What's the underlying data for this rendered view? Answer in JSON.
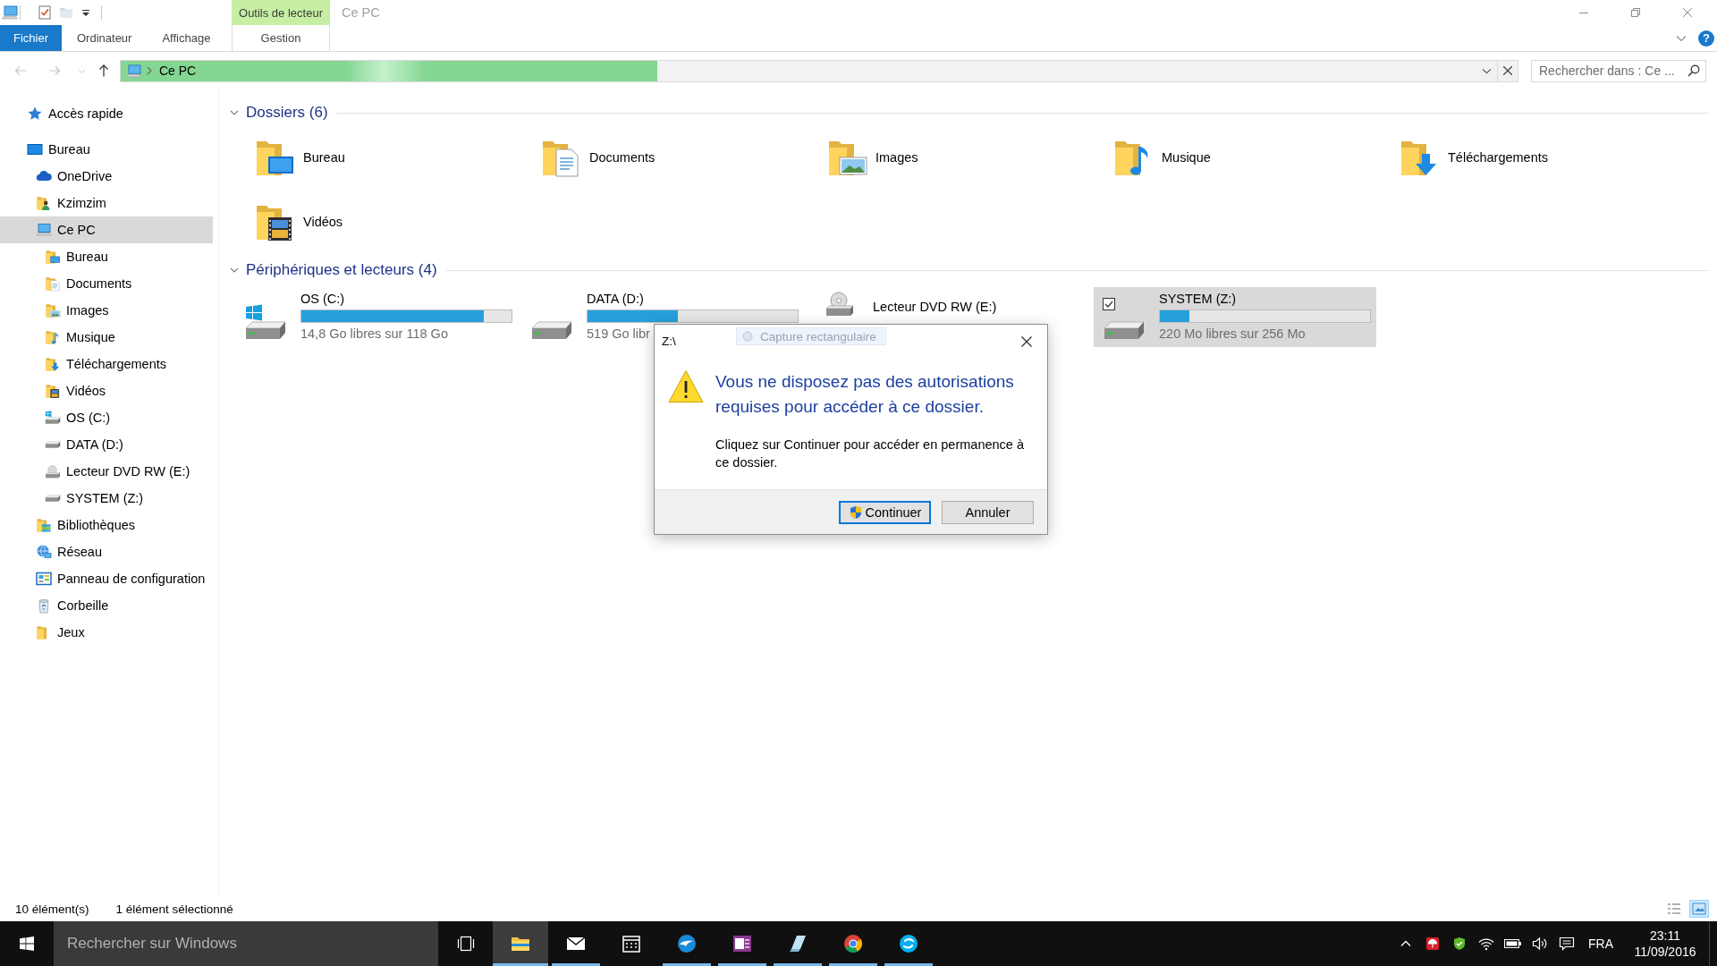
{
  "window": {
    "title": "Ce PC",
    "contextual_group": "Outils de lecteur"
  },
  "ribbon": {
    "tabs": [
      {
        "label": "Fichier",
        "kind": "file",
        "selected": false
      },
      {
        "label": "Ordinateur",
        "kind": "plain",
        "selected": false
      },
      {
        "label": "Affichage",
        "kind": "plain",
        "selected": false
      },
      {
        "label": "Gestion",
        "kind": "contextual",
        "selected": false
      }
    ],
    "help": "?"
  },
  "navigation": {
    "buttons": [
      {
        "kind": "back",
        "disabled": true
      },
      {
        "kind": "forward",
        "disabled": true
      },
      {
        "kind": "recent",
        "disabled": true
      },
      {
        "kind": "up",
        "disabled": false
      }
    ]
  },
  "address_bar": {
    "location": "Ce PC",
    "level": 0.39
  },
  "search": {
    "placeholder": "Rechercher dans : Ce ..."
  },
  "nav_pane": {
    "items": [
      {
        "label": "Accès rapide",
        "kind": "star",
        "selected": false
      },
      {
        "label": "Bureau",
        "kind": "screen",
        "selected": false,
        "children": [
          {
            "label": "OneDrive",
            "kind": "cloud",
            "selected": false
          },
          {
            "label": "Kzimzim",
            "kind": "user",
            "selected": false
          },
          {
            "label": "Ce PC",
            "kind": "computer",
            "selected": true,
            "children": [
              {
                "label": "Bureau",
                "kind": "desktop",
                "selected": false
              },
              {
                "label": "Documents",
                "kind": "documents",
                "selected": false
              },
              {
                "label": "Images",
                "kind": "pictures",
                "selected": false
              },
              {
                "label": "Musique",
                "kind": "music",
                "selected": false
              },
              {
                "label": "Téléchargements",
                "kind": "downloads",
                "selected": false
              },
              {
                "label": "Vidéos",
                "kind": "videos",
                "selected": false
              },
              {
                "label": "OS (C:)",
                "kind": "windows",
                "selected": false
              },
              {
                "label": "DATA (D:)",
                "kind": "disk",
                "selected": false
              },
              {
                "label": "Lecteur DVD RW (E:)",
                "kind": "optical",
                "selected": false
              },
              {
                "label": "SYSTEM (Z:)",
                "kind": "disk",
                "selected": false
              }
            ]
          },
          {
            "label": "Bibliothèques",
            "kind": "library",
            "selected": false
          },
          {
            "label": "Réseau",
            "kind": "network",
            "selected": false
          },
          {
            "label": "Panneau de configuration",
            "kind": "control",
            "selected": false
          },
          {
            "label": "Corbeille",
            "kind": "recycle",
            "selected": false
          },
          {
            "label": "Jeux",
            "kind": "folder",
            "selected": false
          }
        ]
      }
    ]
  },
  "groups": [
    {
      "title": "Dossiers (6)",
      "kind": "folders",
      "expanded": true,
      "items": [
        {
          "label": "Bureau",
          "kind": "desktop",
          "selected": false
        },
        {
          "label": "Documents",
          "kind": "documents",
          "selected": false
        },
        {
          "label": "Images",
          "kind": "pictures",
          "selected": false
        },
        {
          "label": "Musique",
          "kind": "music",
          "selected": false
        },
        {
          "label": "Téléchargements",
          "kind": "downloads",
          "selected": false
        },
        {
          "label": "Vidéos",
          "kind": "videos",
          "selected": false
        }
      ]
    },
    {
      "title": "Périphériques et lecteurs (4)",
      "kind": "drives",
      "expanded": true,
      "items": [
        {
          "label": "OS (C:)",
          "kind": "windows",
          "level": 0.87,
          "free": "14,8 Go libres sur 118 Go",
          "selected": false
        },
        {
          "label": "DATA (D:)",
          "kind": "disk",
          "level": 0.43,
          "free": "519 Go libr",
          "selected": false
        },
        {
          "label": "Lecteur DVD RW (E:)",
          "kind": "optical",
          "selected": false
        },
        {
          "label": "SYSTEM (Z:)",
          "kind": "disk",
          "level": 0.14,
          "free": "220 Mo libres sur 256 Mo",
          "selected": true
        }
      ]
    }
  ],
  "dialog": {
    "title": "Z:\\",
    "instruction": "Vous ne disposez pas des autorisations requises pour accéder à ce dossier.",
    "message": "Cliquez sur Continuer pour accéder en permanence à ce dossier.",
    "buttons": [
      {
        "label": "Continuer",
        "kind": "elevated",
        "default": true
      },
      {
        "label": "Annuler",
        "kind": "plain",
        "default": false
      }
    ]
  },
  "tooltip": {
    "text": "Capture rectangulaire"
  },
  "status_bar": {
    "item_count": "10 élément(s)",
    "selection": "1 élément sélectionné",
    "views": [
      {
        "kind": "details",
        "selected": false
      },
      {
        "kind": "tiles",
        "selected": true
      }
    ]
  },
  "taskbar": {
    "search": {
      "placeholder": "Rechercher sur Windows"
    },
    "apps": [
      {
        "kind": "explorer",
        "running": true,
        "selected": true
      },
      {
        "kind": "mail",
        "running": true,
        "selected": false
      },
      {
        "kind": "calendar",
        "running": false,
        "selected": false
      },
      {
        "kind": "bird",
        "running": true,
        "selected": false
      },
      {
        "kind": "notebook",
        "running": true,
        "selected": false
      },
      {
        "kind": "notecard",
        "running": true,
        "selected": false
      },
      {
        "kind": "browser",
        "running": true,
        "selected": false
      },
      {
        "kind": "chat",
        "running": true,
        "selected": false
      }
    ],
    "tray": {
      "language": "FRA",
      "time": "23:11",
      "date": "11/09/2016"
    }
  }
}
